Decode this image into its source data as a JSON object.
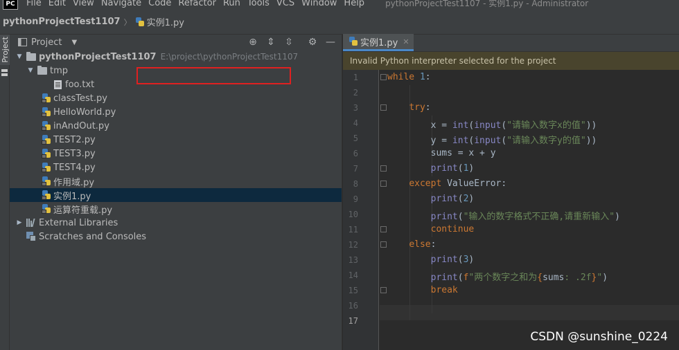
{
  "menubar": {
    "app_icon": "PC",
    "items": [
      "File",
      "Edit",
      "View",
      "Navigate",
      "Code",
      "Refactor",
      "Run",
      "Tools",
      "VCS",
      "Window",
      "Help"
    ],
    "window_title": "pythonProjectTest1107 - 实例1.py - Administrator"
  },
  "navbar": {
    "project": "pythonProjectTest1107",
    "file": "实例1.py"
  },
  "tool_stripe": {
    "project_label": "Project"
  },
  "project_panel": {
    "title": "Project",
    "root": {
      "name": "pythonProjectTest1107",
      "path": "E:\\project\\pythonProjectTest1107"
    },
    "folder_tmp": "tmp",
    "file_foo": "foo.txt",
    "files": [
      "classTest.py",
      "HelloWorld.py",
      "inAndOut.py",
      "TEST2.py",
      "TEST3.py",
      "TEST4.py",
      "作用域.py",
      "实例1.py",
      "运算符重载.py"
    ],
    "external_libraries": "External Libraries",
    "scratches": "Scratches and Consoles"
  },
  "editor": {
    "tab_label": "实例1.py",
    "banner": "Invalid Python interpreter selected for the project",
    "current_line": 17
  },
  "watermark": "CSDN @sunshine_0224",
  "colors": {
    "selection": "#0d293e",
    "banner_bg": "#49442d",
    "highlight_box": "#e02020",
    "tab_underline": "#4a88c7"
  }
}
